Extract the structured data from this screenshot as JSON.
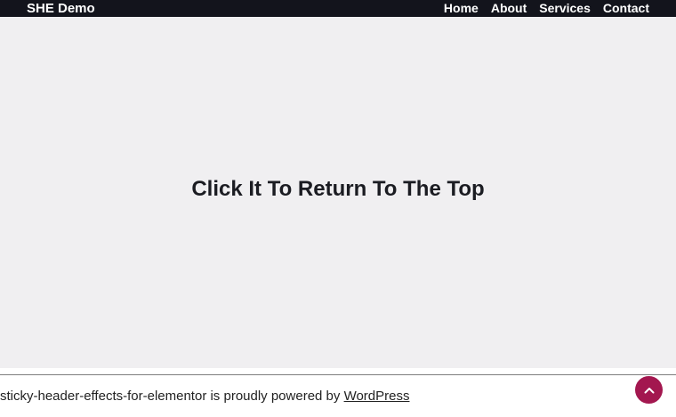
{
  "header": {
    "site_title": "SHE Demo",
    "nav": [
      {
        "label": "Home"
      },
      {
        "label": "About"
      },
      {
        "label": "Services"
      },
      {
        "label": "Contact"
      }
    ]
  },
  "hero": {
    "heading": "Click It To Return To The Top"
  },
  "footer": {
    "text": "sticky-header-effects-for-elementor is proudly powered by",
    "link_label": "WordPress"
  },
  "scroll_top": {
    "icon": "chevron-up-icon"
  },
  "colors": {
    "header_bg": "#13141c",
    "hero_bg": "#f0eff1",
    "accent": "#a3174f"
  }
}
